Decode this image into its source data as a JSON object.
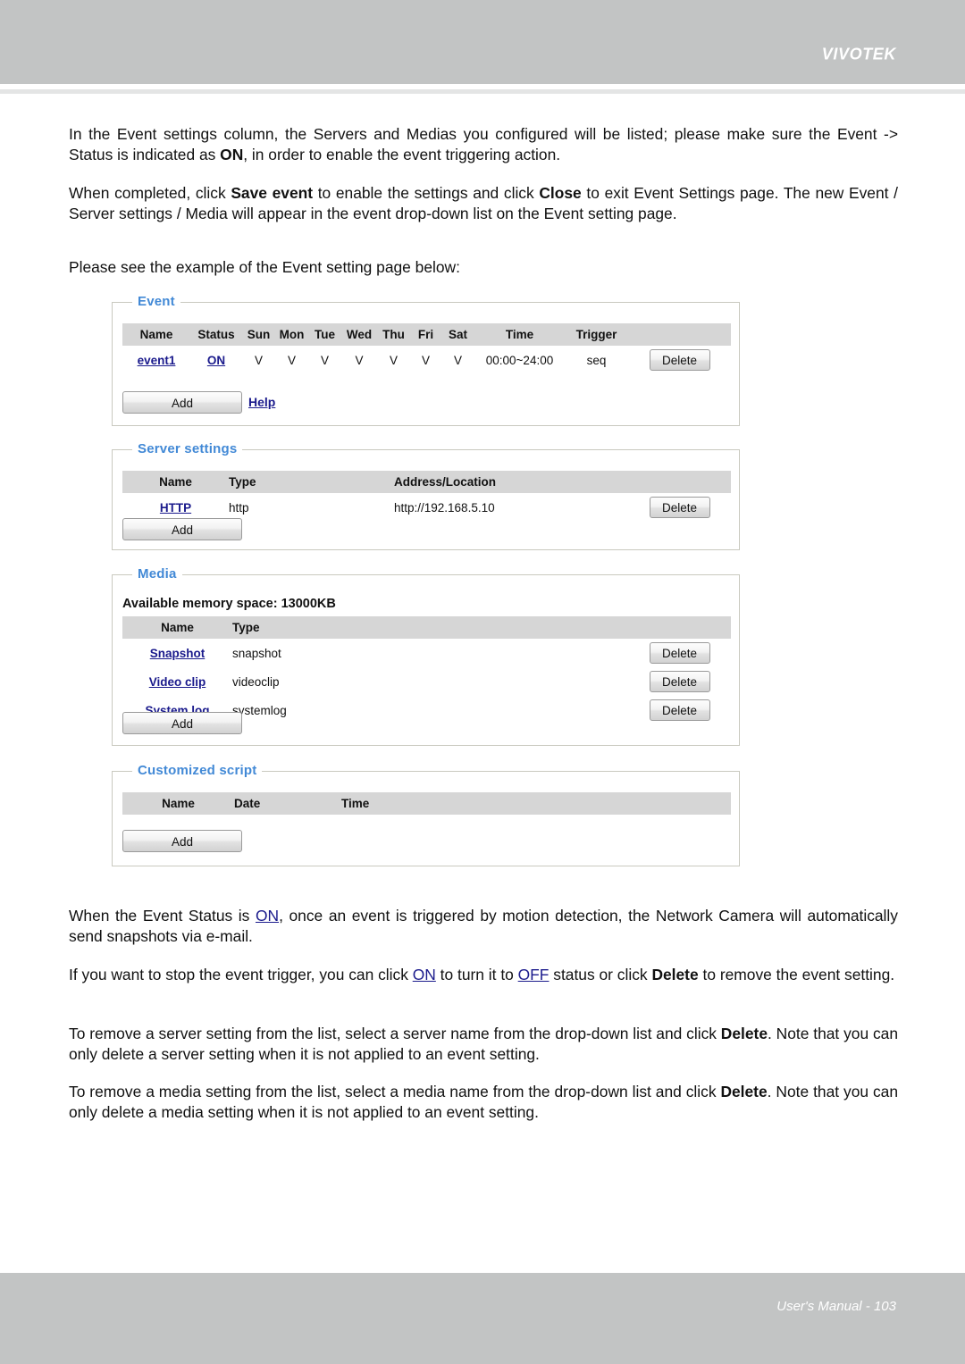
{
  "header": {
    "brand": "VIVOTEK"
  },
  "footer": {
    "label": "User's Manual - 103"
  },
  "paragraphs": {
    "p1_a": "In the Event settings column, the Servers and Medias you configured will be listed; please make sure the Event -> Status is indicated as ",
    "p1_on": "ON",
    "p1_b": ", in order to enable the event triggering action.",
    "p2_a": "When completed, click ",
    "p2_save": "Save event",
    "p2_b": " to enable the settings and click ",
    "p2_close": "Close",
    "p2_c": " to exit Event Settings page. The new Event / Server settings / Media will appear in the event drop-down list on the Event setting page.",
    "p3": "Please see the example of the Event setting page below:",
    "p4_a": "When the Event Status is ",
    "p4_on": "ON",
    "p4_b": ", once an event is triggered by motion detection, the Network Camera will automatically send snapshots via e-mail.",
    "p5_a": "If you want to stop the event trigger, you can click ",
    "p5_on": "ON",
    "p5_b": " to turn it to ",
    "p5_off": "OFF",
    "p5_c": " status or click ",
    "p5_delete": "Delete",
    "p5_d": " to remove the event setting.",
    "p6_a": "To remove a server setting from the list, select a server name from the drop-down list and click ",
    "p6_delete": "Delete",
    "p6_b": ". Note that you can only delete a server setting when it is not applied to an event setting.",
    "p7_a": "To remove a media setting from the list, select a media name from the drop-down list and click ",
    "p7_delete": "Delete",
    "p7_b": ". Note that you can only delete a media setting when it is not applied to an event setting."
  },
  "event_panel": {
    "title": "Event",
    "columns": [
      "Name",
      "Status",
      "Sun",
      "Mon",
      "Tue",
      "Wed",
      "Thu",
      "Fri",
      "Sat",
      "Time",
      "Trigger",
      ""
    ],
    "rows": [
      {
        "name": "event1",
        "status": "ON",
        "sun": "V",
        "mon": "V",
        "tue": "V",
        "wed": "V",
        "thu": "V",
        "fri": "V",
        "sat": "V",
        "time": "00:00~24:00",
        "trigger": "seq",
        "delete_label": "Delete"
      }
    ],
    "add_label": "Add",
    "help_label": "Help"
  },
  "server_panel": {
    "title": "Server settings",
    "columns": [
      "Name",
      "Type",
      "Address/Location",
      ""
    ],
    "rows": [
      {
        "name": "HTTP",
        "type": "http",
        "address": "http://192.168.5.10",
        "delete_label": "Delete"
      }
    ],
    "add_label": "Add"
  },
  "media_panel": {
    "title": "Media",
    "memory_line": "Available memory space: 13000KB",
    "columns": [
      "Name",
      "Type",
      ""
    ],
    "rows": [
      {
        "name": "Snapshot",
        "type": "snapshot",
        "delete_label": "Delete"
      },
      {
        "name": "Video clip",
        "type": "videoclip",
        "delete_label": "Delete"
      },
      {
        "name": "System log",
        "type": "systemlog",
        "delete_label": "Delete"
      }
    ],
    "add_label": "Add"
  },
  "script_panel": {
    "title": "Customized script",
    "columns": [
      "Name",
      "Date",
      "Time",
      ""
    ],
    "rows": [],
    "add_label": "Add"
  },
  "colors": {
    "chrome_gray": "#c2c4c4",
    "panel_title_blue": "#4289d6",
    "link_navy": "#1a1a8c",
    "table_header_gray": "#d6d6d6",
    "panel_border": "#c9c9bf"
  }
}
